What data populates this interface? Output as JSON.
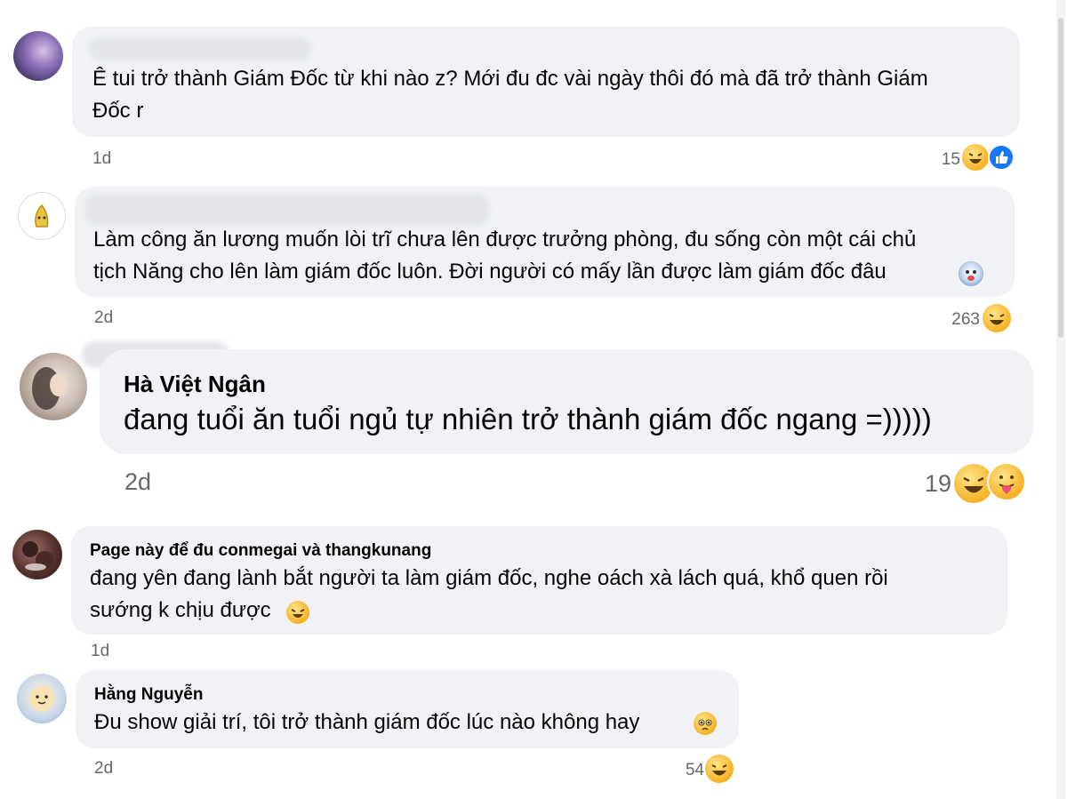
{
  "comments": [
    {
      "author": "",
      "lines": [
        "Ê tui trở thành Giám Đốc từ khi nào z? Mới đu đc vài ngày thôi đó mà đã trở thành Giám",
        "Đốc r"
      ],
      "time": "1d",
      "reactions": "15",
      "reaction_icons": [
        "haha-icon",
        "like-icon"
      ]
    },
    {
      "author": "",
      "lines": [
        "Làm công ăn lương muốn lòi trĩ chưa lên được trưởng phòng, đu sống còn một cái chủ",
        "tịch Năng cho lên làm giám đốc luôn. Đời người có mấy lần được làm giám đốc đâu"
      ],
      "time": "2d",
      "reactions": "263",
      "reaction_icons": [
        "haha-icon"
      ]
    },
    {
      "author": "Hà Việt Ngân",
      "lines": [
        "đang tuổi ăn tuổi ngủ tự nhiên trở thành giám đốc ngang =)))))"
      ],
      "time": "2d",
      "reactions": "19",
      "reaction_icons": [
        "haha-icon",
        "care-icon"
      ]
    },
    {
      "author": "Page này để đu conmegai và thangkunang",
      "lines": [
        "đang yên đang lành bắt người ta làm giám đốc, nghe oách xà lách quá, khổ quen rồi",
        "sướng k chịu được"
      ],
      "time": "1d",
      "reactions": "",
      "reaction_icons": []
    },
    {
      "author": "Hằng Nguyễn",
      "lines": [
        "Đu show giải trí, tôi trở thành giám đốc lúc nào không hay"
      ],
      "time": "2d",
      "reactions": "54",
      "reaction_icons": [
        "haha-icon"
      ]
    }
  ],
  "colors": {
    "bubble": "#f0f2f5",
    "meta": "#65676b",
    "like": "#1877f2",
    "haha": "#f7b125"
  }
}
